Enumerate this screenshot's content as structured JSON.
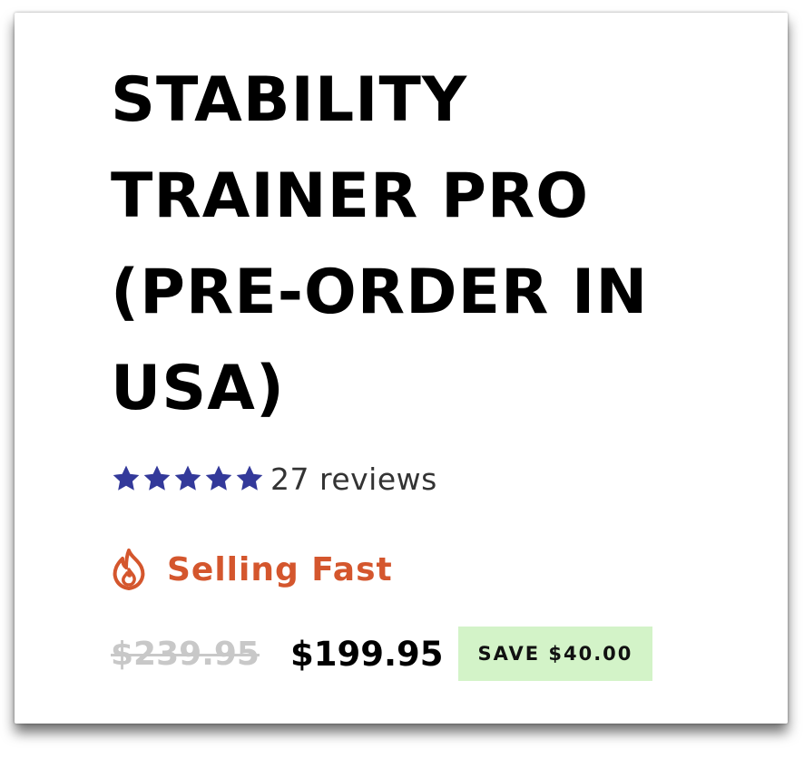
{
  "product": {
    "title": "STABILITY TRAINER PRO (PRE-ORDER IN USA)"
  },
  "rating": {
    "stars": 5,
    "max_stars": 5,
    "star_color": "#33399a",
    "reviews_label": "27 reviews",
    "star_icon": "star-icon"
  },
  "status": {
    "label": "Selling Fast",
    "icon": "fire-icon",
    "color": "#d4562d"
  },
  "pricing": {
    "original_price": "$239.95",
    "sale_price": "$199.95",
    "savings_label": "SAVE $40.00",
    "savings_badge_color": "#d3f3c8"
  }
}
